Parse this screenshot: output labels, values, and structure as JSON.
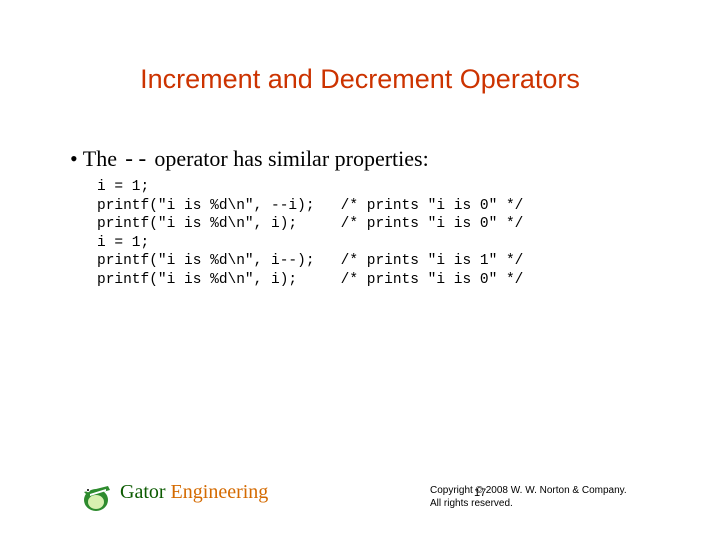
{
  "title": "Increment and Decrement Operators",
  "bullet": {
    "prefix": "• The ",
    "op": "--",
    "suffix": " operator has similar properties:"
  },
  "code": "i = 1;\nprintf(\"i is %d\\n\", --i);   /* prints \"i is 0\" */\nprintf(\"i is %d\\n\", i);     /* prints \"i is 0\" */\ni = 1;\nprintf(\"i is %d\\n\", i--);   /* prints \"i is 1\" */\nprintf(\"i is %d\\n\", i);     /* prints \"i is 0\" */",
  "footer": {
    "brand1": "Gator ",
    "brand2": "Engineering",
    "copyright_line1": "Copyright © 2008 W. W. Norton & Company.",
    "copyright_line2": "All rights reserved.",
    "page": "17"
  }
}
